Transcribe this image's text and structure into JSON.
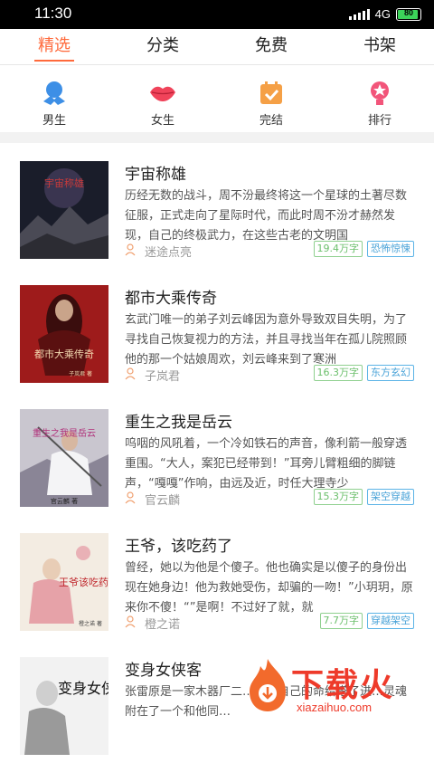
{
  "status": {
    "time": "11:30",
    "network": "4G",
    "battery": "80"
  },
  "tabs": [
    {
      "label": "精选",
      "active": true
    },
    {
      "label": "分类",
      "active": false
    },
    {
      "label": "免费",
      "active": false
    },
    {
      "label": "书架",
      "active": false
    }
  ],
  "categories": [
    {
      "label": "男生",
      "icon": "male-icon",
      "color": "#3d8fe6"
    },
    {
      "label": "女生",
      "icon": "lips-icon",
      "color": "#f0435a"
    },
    {
      "label": "完结",
      "icon": "calendar-check-icon",
      "color": "#f5a046"
    },
    {
      "label": "排行",
      "icon": "trophy-icon",
      "color": "#f2557a"
    }
  ],
  "books": [
    {
      "title": "宇宙称雄",
      "desc": "历经无数的战斗，周不汾最终将这一个星球的土著尽数征服，正式走向了星际时代，而此时周不汾才赫然发现，自己的终极武力，在这些古老的文明国",
      "author": "迷途点亮",
      "words": "19.4万字",
      "category": "恐怖惊悚"
    },
    {
      "title": "都市大乘传奇",
      "desc": "玄武门唯一的弟子刘云峰因为意外导致双目失明，为了寻找自己恢复视力的方法，并且寻找当年在孤儿院照顾他的那一个姑娘周欢，刘云峰来到了寒洲",
      "author": "子岚君",
      "words": "16.3万字",
      "category": "东方玄幻"
    },
    {
      "title": "重生之我是岳云",
      "desc": "呜咽的风吼着，一个冷如铁石的声音，像利箭一般穿透重围。“大人，案犯已经带到！”耳旁儿臂粗细的脚链声，“嘎嘎”作响，由远及近，时任大理寺少",
      "author": "官云麟",
      "words": "15.3万字",
      "category": "架空穿越"
    },
    {
      "title": "王爷，该吃药了",
      "desc": "曾经，她以为他是个傻子。他也确实是以傻子的身份出现在她身边！他为救她受伤，却骗的一吻！”小玥玥，原来你不傻！“”是啊！不过好了就，就",
      "author": "橙之诺",
      "words": "7.7万字",
      "category": "穿越架空"
    },
    {
      "title": "变身女侠客",
      "desc": "张雷原是一家木器厂二…却把自己的命给搭了进…灵魂附在了一个和他同…",
      "author": "",
      "words": "",
      "category": ""
    }
  ],
  "covers": [
    {
      "text": "宇宙称雄"
    },
    {
      "text": "都市大乘传奇",
      "sub": "子岚君 著"
    },
    {
      "text": "重生之我是岳云",
      "sub": "官云麟 著"
    },
    {
      "text": "王爷该吃药了",
      "sub": "橙之诺 著"
    },
    {
      "text": "变身女侠"
    }
  ],
  "watermark": {
    "text": "下载火",
    "url": "xiazaihuo.com"
  }
}
